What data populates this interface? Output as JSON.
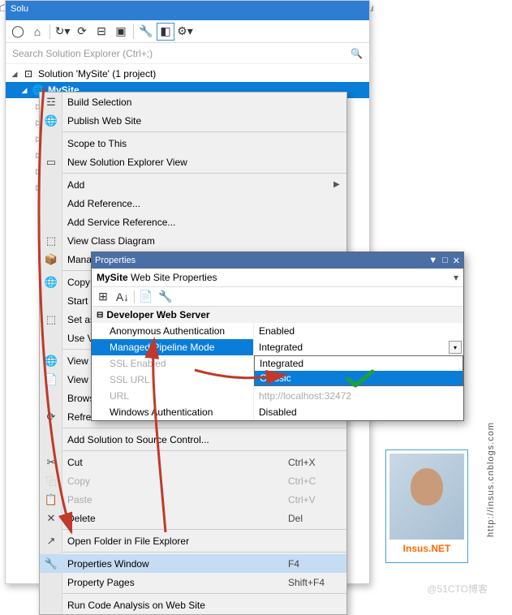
{
  "titlebar": "Solu",
  "search_placeholder": "Search Solution Explorer (Ctrl+;)",
  "solution_label": "Solution 'MySite' (1 project)",
  "project_name": "MySite",
  "context_menu": {
    "build": "Build Selection",
    "publish": "Publish Web Site",
    "scope": "Scope to This",
    "new_view": "New Solution Explorer View",
    "add": "Add",
    "add_ref": "Add Reference...",
    "add_svc": "Add Service Reference...",
    "class_diag": "View Class Diagram",
    "nuget": "Manage N",
    "copy_web": "Copy Web",
    "start_opt": "Start Optio",
    "set_start": "Set as Star",
    "use_visual": "Use Visual",
    "view_br": "View in Br",
    "view_pa": "View in Pa",
    "browse": "Browse W",
    "refresh": "Refresh Fo",
    "add_src": "Add Solution to Source Control...",
    "cut": "Cut",
    "cut_sc": "Ctrl+X",
    "copy": "Copy",
    "copy_sc": "Ctrl+C",
    "paste": "Paste",
    "paste_sc": "Ctrl+V",
    "delete": "Delete",
    "delete_sc": "Del",
    "open_folder": "Open Folder in File Explorer",
    "props_win": "Properties Window",
    "props_sc": "F4",
    "prop_pages": "Property Pages",
    "pages_sc": "Shift+F4",
    "run_analysis": "Run Code Analysis on Web Site"
  },
  "properties": {
    "title": "Properties",
    "subtitle_name": "MySite",
    "subtitle_type": "Web Site Properties",
    "category": "Developer Web Server",
    "rows": {
      "anon_auth": {
        "name": "Anonymous Authentication",
        "value": "Enabled"
      },
      "pipeline": {
        "name": "Managed Pipeline Mode",
        "value": "Integrated"
      },
      "ssl_enabled": {
        "name": "SSL Enabled",
        "value": ""
      },
      "ssl_url": {
        "name": "SSL URL",
        "value": ""
      },
      "url": {
        "name": "URL",
        "value": "http://localhost:32472"
      },
      "win_auth": {
        "name": "Windows Authentication",
        "value": "Disabled"
      }
    },
    "dropdown": {
      "opt1": "Integrated",
      "opt2": "Classic"
    }
  },
  "card": {
    "name": "Insus.NET",
    "url": "http://insus.cnblogs.com"
  },
  "watermark": "@51CTO博客"
}
